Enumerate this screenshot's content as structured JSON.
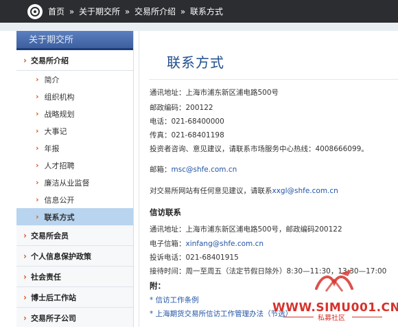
{
  "breadcrumb": {
    "items": [
      "首页",
      "关于期交所",
      "交易所介绍",
      "联系方式"
    ],
    "separator": "»"
  },
  "sidebar": {
    "header": "关于期交所",
    "section_intro": "交易所介绍",
    "sub_items": [
      {
        "label": "简介"
      },
      {
        "label": "组织机构"
      },
      {
        "label": "战略规划"
      },
      {
        "label": "大事记"
      },
      {
        "label": "年报"
      },
      {
        "label": "人才招聘"
      },
      {
        "label": "廉洁从业监督"
      },
      {
        "label": "信息公开"
      },
      {
        "label": "联系方式",
        "active": true
      }
    ],
    "groups": [
      {
        "label": "交易所会员"
      },
      {
        "label": "个人信息保护政策"
      },
      {
        "label": "社会责任"
      },
      {
        "label": "博士后工作站"
      },
      {
        "label": "交易所子公司"
      }
    ]
  },
  "main": {
    "title": "联系方式",
    "address": "通讯地址：上海市浦东新区浦电路500号",
    "postcode": "邮政编码：200122",
    "phone": "电话：021-68400000",
    "fax": "传真：021-68401198",
    "hotline": "投资者咨询、意见建议，请联系市场服务中心热线：4008666099。",
    "email_label": "邮箱：",
    "email": "msc@shfe.com.cn",
    "website_feedback_label": "对交易所网站有任何意见建议，请联系",
    "website_feedback_email": "xxgl@shfe.com.cn",
    "petition_heading": "信访联系",
    "petition_address": "通讯地址：上海市浦东新区浦电路500号，邮政编码200122",
    "petition_email_label": "电子信箱：",
    "petition_email": "xinfang@shfe.com.cn",
    "petition_phone": "投诉电话：021-68401915",
    "reception_time": "接待时间：周一至周五（法定节假日除外）8:30—11:30，13:30—17:00",
    "attachment_heading": "附：",
    "attachments": [
      "* 信访工作条例",
      "* 上海期货交易所信访工作管理办法（节选）"
    ]
  },
  "watermark": {
    "site": "WWW.SIMU001.CN",
    "tagline": "私募社区",
    "color": "#d6322b"
  },
  "colors": {
    "header_bg": "#2b2d31",
    "title_blue": "#1f4e8c",
    "link_blue": "#2255a4",
    "chevron_orange": "#d9541b",
    "active_bg": "#b8d4ef"
  }
}
